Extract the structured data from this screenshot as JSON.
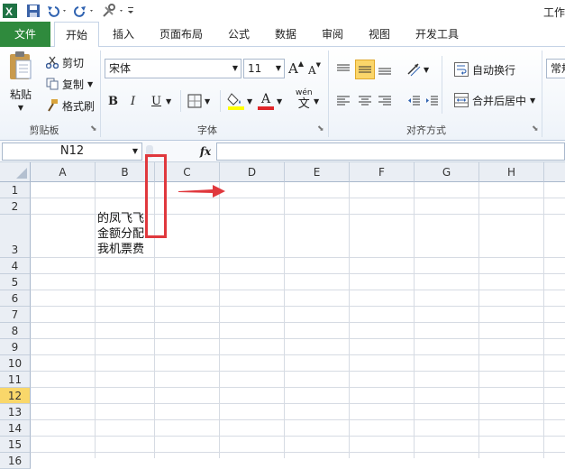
{
  "app": {
    "title": "工作"
  },
  "tabs": [
    "文件",
    "开始",
    "插入",
    "页面布局",
    "公式",
    "数据",
    "审阅",
    "视图",
    "开发工具"
  ],
  "clipboard": {
    "paste": "粘贴",
    "cut": "剪切",
    "copy": "复制",
    "format_painter": "格式刷",
    "group": "剪贴板"
  },
  "font": {
    "name": "宋体",
    "size": "11",
    "bold": "B",
    "italic": "I",
    "underline": "U",
    "group": "字体",
    "grow": "A",
    "shrink": "A",
    "font_color_letter": "A",
    "wen": "wén",
    "wen_char": "文"
  },
  "alignment": {
    "wrap": "自动换行",
    "merge": "合并后居中",
    "group": "对齐方式"
  },
  "number": {
    "format": "常规"
  },
  "formula_bar": {
    "name_box": "N12",
    "fx": "fx",
    "value": ""
  },
  "sheet": {
    "columns": [
      "A",
      "B",
      "C",
      "D",
      "E",
      "F",
      "G",
      "H"
    ],
    "rows": [
      "1",
      "2",
      "3",
      "4",
      "5",
      "6",
      "7",
      "8",
      "9",
      "10",
      "11",
      "12",
      "13",
      "14",
      "15",
      "16"
    ],
    "selected_row": "12",
    "cell_b3": "的凤飞飞\n金额分配\n我机票费"
  },
  "colors": {
    "file_tab": "#2f8a3d",
    "annotation": "#e0383d",
    "selected_header": "#f9d76a"
  }
}
